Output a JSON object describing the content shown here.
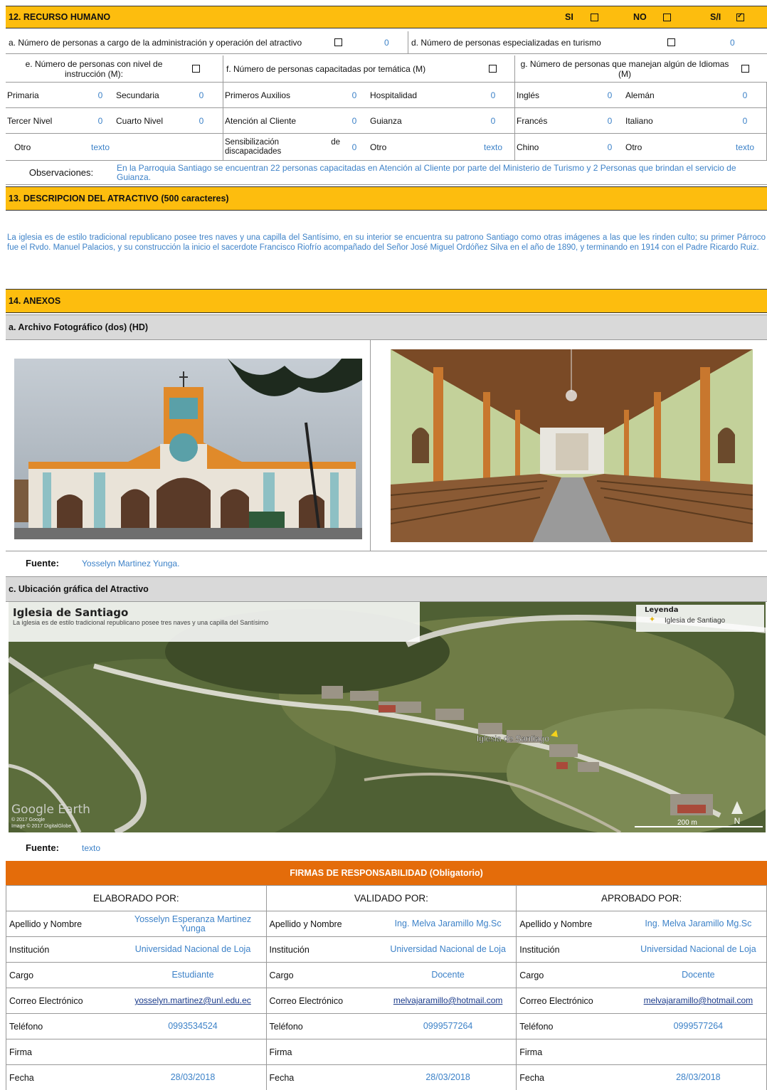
{
  "section12": {
    "title": "12. RECURSO HUMANO",
    "si_label": "SI",
    "no_label": "NO",
    "si_label2": "S/I",
    "row_a": {
      "label": "a. Número de personas a cargo de la administración y operación del atractivo",
      "value": "0"
    },
    "row_d": {
      "label": "d. Número de personas especializadas en turismo",
      "value": "0"
    },
    "head_e": "e. Número de personas con nivel de instrucción (M):",
    "head_f": "f. Número de personas capacitadas por temática (M)",
    "head_g": "g. Número de personas que manejan algún de Idiomas (M)",
    "rows": [
      [
        "Primaria",
        "0",
        "Secundaria",
        "0",
        "Primeros Auxilios",
        "0",
        "Hospitalidad",
        "0",
        "Inglés",
        "0",
        "Alemán",
        "0"
      ],
      [
        "Tercer Nivel",
        "0",
        "Cuarto Nivel",
        "0",
        "Atención al Cliente",
        "0",
        "Guianza",
        "0",
        "Francés",
        "0",
        "Italiano",
        "0"
      ],
      [
        "Otro",
        "texto",
        "",
        "",
        "Sensibilización de discapacidades",
        "0",
        "Otro",
        "texto",
        "Chino",
        "0",
        "Otro",
        "texto"
      ]
    ],
    "obs_label": "Observaciones:",
    "obs_text": "En la Parroquia Santiago se encuentran 22 personas capacitadas en Atención al Cliente por parte del Ministerio de Turismo y 2 Personas que brindan el servicio de Guianza."
  },
  "section13": {
    "title": "13. DESCRIPCION DEL ATRACTIVO (500 caracteres)",
    "text": "La iglesia es de estilo tradicional republicano posee tres naves y una capilla del Santísimo, en su interior se encuentra su patrono Santiago como otras imágenes a las que les rinden culto; su primer Párroco fue el Rvdo. Manuel Palacios, y su construcción la inicio el sacerdote Francisco Riofrío acompañado del Señor José Miguel Ordóñez Silva en el año de 1890, y terminando en 1914 con el Padre Ricardo Ruiz."
  },
  "section14": {
    "title": "14. ANEXOS",
    "photos_title": "a. Archivo Fotográfico (dos) (HD)",
    "fuente_label": "Fuente:",
    "fuente_value": "Yosselyn Martinez Yunga.",
    "map_title": "c. Ubicación gráfica del Atractivo",
    "map_place": "Iglesia de Santiago",
    "map_desc": "La iglesia es de estilo tradicional republicano posee tres naves y una capilla del Santísimo",
    "map_legend_title": "Leyenda",
    "map_legend_item": "Iglesia de Santiago",
    "map_pin_label": "Iglesia de Santiago",
    "map_brand": "Google Earth",
    "map_credit1": "© 2017 Google",
    "map_credit2": "Image © 2017 DigitalGlobe",
    "map_scale": "200 m",
    "fuente2_value": "texto"
  },
  "firmas": {
    "title": "FIRMAS DE RESPONSABILIDAD (Obligatorio)",
    "cols": [
      "ELABORADO POR:",
      "VALIDADO  POR:",
      "APROBADO POR:"
    ],
    "labels": [
      "Apellido y Nombre",
      "Institución",
      "Cargo",
      "Correo Electrónico",
      "Teléfono",
      "Firma",
      "Fecha"
    ],
    "elaborado": [
      "Yosselyn Esperanza Martinez Yunga",
      "Universidad Nacional de Loja",
      "Estudiante",
      "yosselyn.martinez@unl.edu.ec",
      "0993534524",
      "",
      "28/03/2018"
    ],
    "validado": [
      "Ing. Melva Jaramillo Mg.Sc",
      "Universidad Nacional de Loja",
      "Docente",
      "melvajaramillo@hotmail.com",
      "0999577264",
      "",
      "28/03/2018"
    ],
    "aprobado": [
      "Ing. Melva Jaramillo Mg.Sc",
      "Universidad Nacional de Loja",
      "Docente",
      "melvajaramillo@hotmail.com",
      "0999577264",
      "",
      "28/03/2018"
    ]
  },
  "colors": {
    "header": "#fdbd0e",
    "firmas": "#e46c0a",
    "value": "#3d82c8"
  }
}
